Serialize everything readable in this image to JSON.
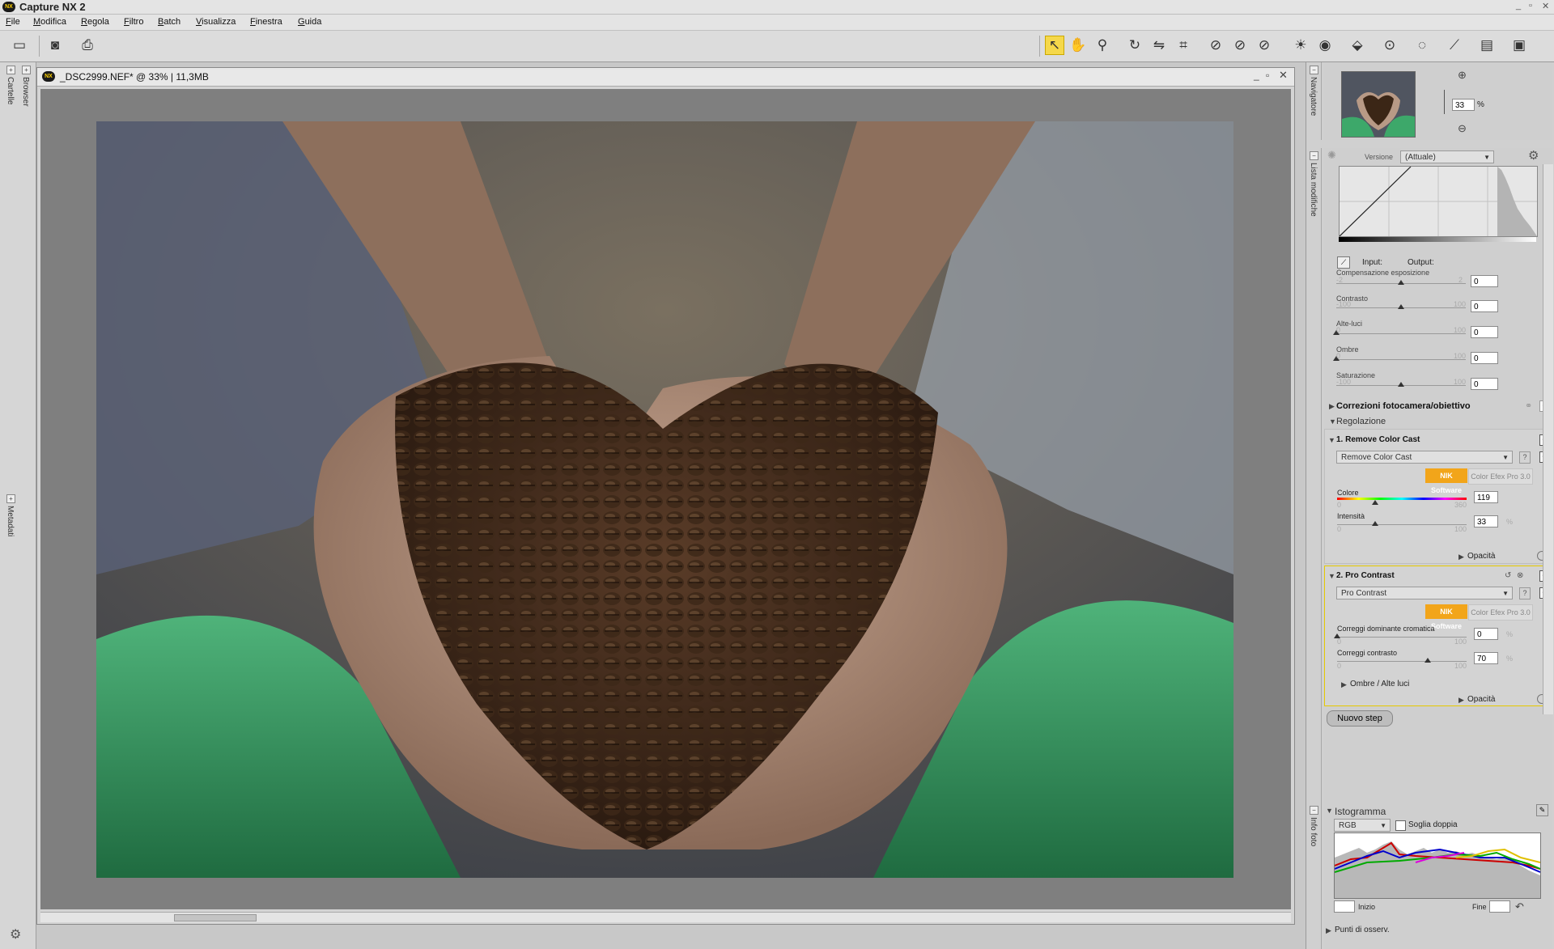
{
  "app": {
    "title": "Capture NX 2",
    "logo_text": "NX",
    "window_controls": [
      "_",
      "▫",
      "✕"
    ]
  },
  "menu": [
    "File",
    "Modifica",
    "Regola",
    "Filtro",
    "Batch",
    "Visualizza",
    "Finestra",
    "Guida"
  ],
  "toolbar": {
    "icons": [
      "browser-toggle-icon",
      "camera-icon",
      "print-icon",
      "arrow-select-icon",
      "hand-icon",
      "zoom-icon",
      "rotate-icon",
      "straighten-icon",
      "crop-icon",
      "red-eye-icon",
      "brush-icon",
      "lasso-icon",
      "control-point-icon",
      "eye-icon",
      "tag-icon",
      "color-point-plus-icon",
      "selection-plus-icon",
      "pen-plus-icon",
      "gradient-plus-icon",
      "fill-plus-icon"
    ]
  },
  "left_dock": {
    "tabs": [
      "Cartelle",
      "Browser",
      "Metadati"
    ]
  },
  "document": {
    "title": "_DSC2999.NEF* @ 33% | 11,3MB",
    "logo_text": "NX"
  },
  "navigator": {
    "tab_label": "Navigatore",
    "zoom_value": "33",
    "zoom_unit": "%"
  },
  "edit_list": {
    "tab_label": "Lista modifiche",
    "version_label": "Versione",
    "version_value": "(Attuale)",
    "curve": {
      "input_label": "Input:",
      "output_label": "Output:"
    },
    "sliders": [
      {
        "label": "Compensazione esposizione",
        "min": "-2",
        "max": "2",
        "value": "0"
      },
      {
        "label": "Contrasto",
        "min": "-100",
        "max": "100",
        "value": "0"
      },
      {
        "label": "Alte-luci",
        "min": "0",
        "max": "100",
        "value": "0"
      },
      {
        "label": "Ombre",
        "min": "0",
        "max": "100",
        "value": "0"
      },
      {
        "label": "Saturazione",
        "min": "-100",
        "max": "100",
        "value": "0"
      }
    ],
    "camera_corrections_label": "Correzioni fotocamera/obiettivo",
    "adjustment_label": "Regolazione",
    "step1": {
      "title": "1. Remove Color Cast",
      "filter": "Remove Color Cast",
      "help": "?",
      "nik_label": "NIK Software",
      "cefex_label": "Color Efex Pro 3.0",
      "color_label": "Colore",
      "color_min": "0",
      "color_max": "360",
      "color_value": "119",
      "intensity_label": "Intensità",
      "intensity_min": "0",
      "intensity_max": "100",
      "intensity_value": "33",
      "percent": "%",
      "opacity_label": "Opacità"
    },
    "step2": {
      "title": "2. Pro Contrast",
      "filter": "Pro Contrast",
      "help": "?",
      "nik_label": "NIK Software",
      "cefex_label": "Color Efex Pro 3.0",
      "cast_label": "Correggi dominante cromatica",
      "cast_min": "0",
      "cast_max": "100",
      "cast_value": "0",
      "contrast_label": "Correggi contrasto",
      "contrast_min": "0",
      "contrast_max": "100",
      "contrast_value": "70",
      "percent": "%",
      "shadows_label": "Ombre / Alte luci",
      "opacity_label": "Opacità"
    },
    "new_step_label": "Nuovo step"
  },
  "histogram": {
    "tab_label": "Info foto",
    "title": "Istogramma",
    "channel": "RGB",
    "dual_threshold_label": "Soglia doppia",
    "start_label": "Inizio",
    "end_label": "Fine",
    "start_value": "",
    "end_value": "",
    "watch_points_label": "Punti di osserv."
  },
  "colors": {
    "active_tool": "#f5d84a",
    "step_border": "#e5c900",
    "nik_orange": "#f2a51a"
  }
}
